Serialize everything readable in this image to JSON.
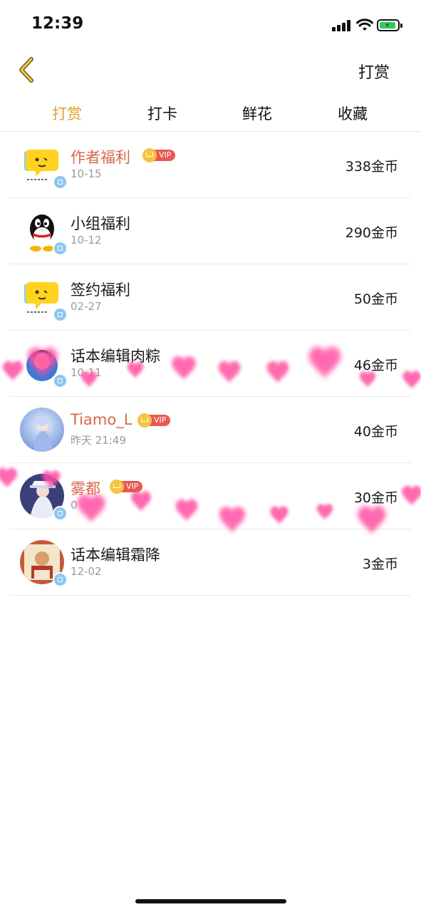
{
  "status_bar": {
    "time": "12:39"
  },
  "nav": {
    "title_right": "打赏"
  },
  "tabs": [
    {
      "label": "打赏",
      "active": true
    },
    {
      "label": "打卡",
      "active": false
    },
    {
      "label": "鲜花",
      "active": false
    },
    {
      "label": "收藏",
      "active": false
    }
  ],
  "badge_label": "官",
  "vip_label": "VIP",
  "rows": [
    {
      "name": "作者福利",
      "date": "10-15",
      "amount": "338金币",
      "vip": true
    },
    {
      "name": "小组福利",
      "date": "10-12",
      "amount": "290金币",
      "vip": false
    },
    {
      "name": "签约福利",
      "date": "02-27",
      "amount": "50金币",
      "vip": false
    },
    {
      "name": "话本编辑肉粽",
      "date": "10-11",
      "amount": "46金币",
      "vip": false
    },
    {
      "name": "Tiamo_L",
      "date": "昨天 21:49",
      "amount": "40金币",
      "vip": true
    },
    {
      "name": "雾都",
      "date": "0",
      "amount": "30金币",
      "vip": true
    },
    {
      "name": "话本编辑霜降",
      "date": "12-02",
      "amount": "3金币",
      "vip": false
    }
  ],
  "colors": {
    "accent": "#e2a129",
    "vip_name": "#d9674a",
    "vip_tag": "#e8584f",
    "heart": "#ff4fa3"
  }
}
